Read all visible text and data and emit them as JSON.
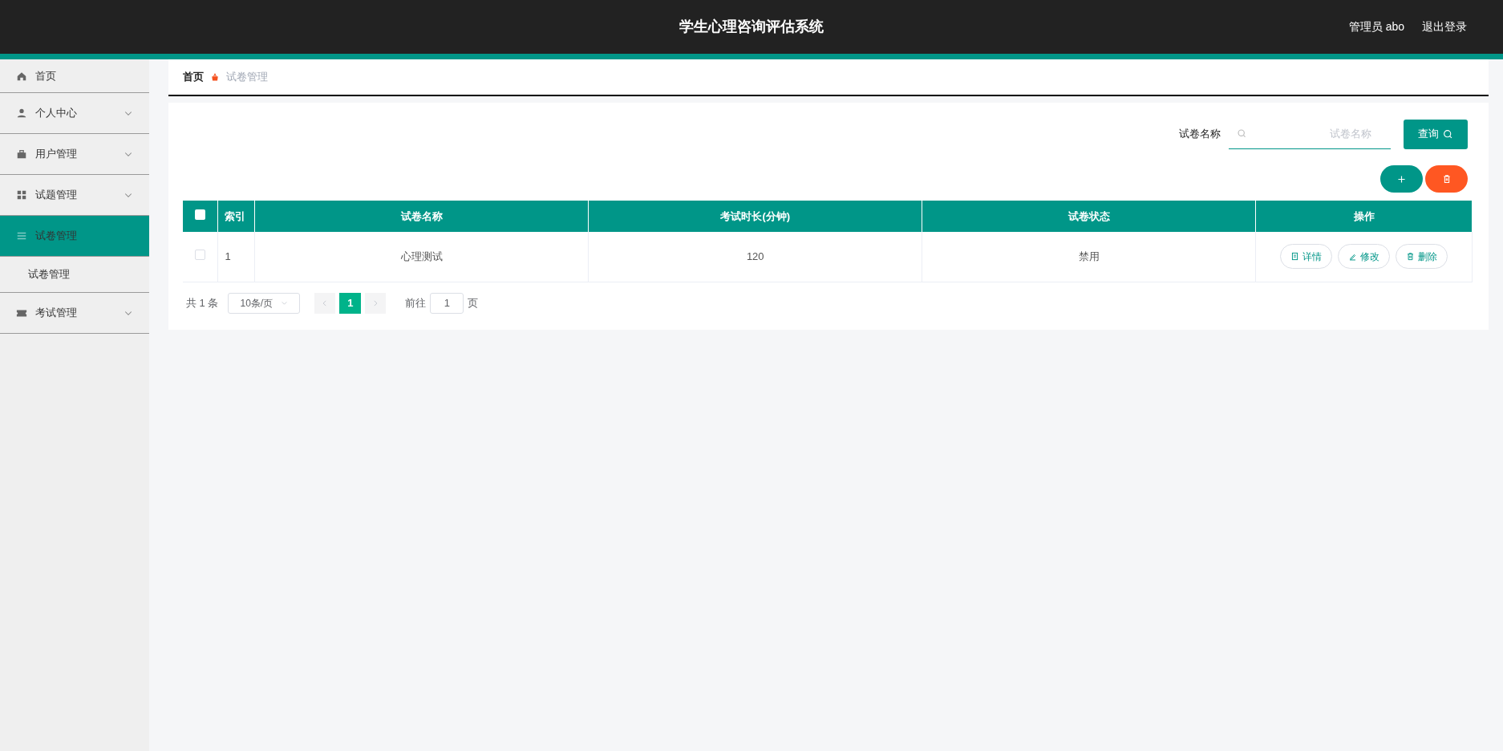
{
  "header": {
    "title": "学生心理咨询评估系统",
    "user": "管理员 abo",
    "logout": "退出登录"
  },
  "sidebar": {
    "items": [
      {
        "label": "首页",
        "expandable": false,
        "selected": false
      },
      {
        "label": "个人中心",
        "expandable": true,
        "selected": false
      },
      {
        "label": "用户管理",
        "expandable": true,
        "selected": false
      },
      {
        "label": "试题管理",
        "expandable": true,
        "selected": false
      },
      {
        "label": "试卷管理",
        "expandable": false,
        "selected": true,
        "children": [
          {
            "label": "试卷管理",
            "selected": false
          }
        ]
      },
      {
        "label": "考试管理",
        "expandable": true,
        "selected": false
      }
    ]
  },
  "breadcrumb": [
    "首页",
    "试卷管理"
  ],
  "search": {
    "label": "试卷名称",
    "placeholder": "试卷名称",
    "button": "查询"
  },
  "table": {
    "select_all_checked": false,
    "columns": [
      "索引",
      "试卷名称",
      "考试时长(分钟)",
      "试卷状态",
      "操作"
    ],
    "rows": [
      {
        "checked": false,
        "cells": [
          "1",
          "心理测试",
          "120",
          "禁用"
        ],
        "actions": [
          {
            "kind": "detail",
            "label": "详情"
          },
          {
            "kind": "edit",
            "label": "修改"
          },
          {
            "kind": "delete",
            "label": "删除"
          }
        ]
      }
    ]
  },
  "pagination": {
    "total": "共 1 条",
    "page_size": "10条/页",
    "pages": [
      {
        "label": "1",
        "selected": true
      }
    ],
    "goto_label": "前往",
    "goto_value": "1",
    "goto_suffix": "页"
  }
}
